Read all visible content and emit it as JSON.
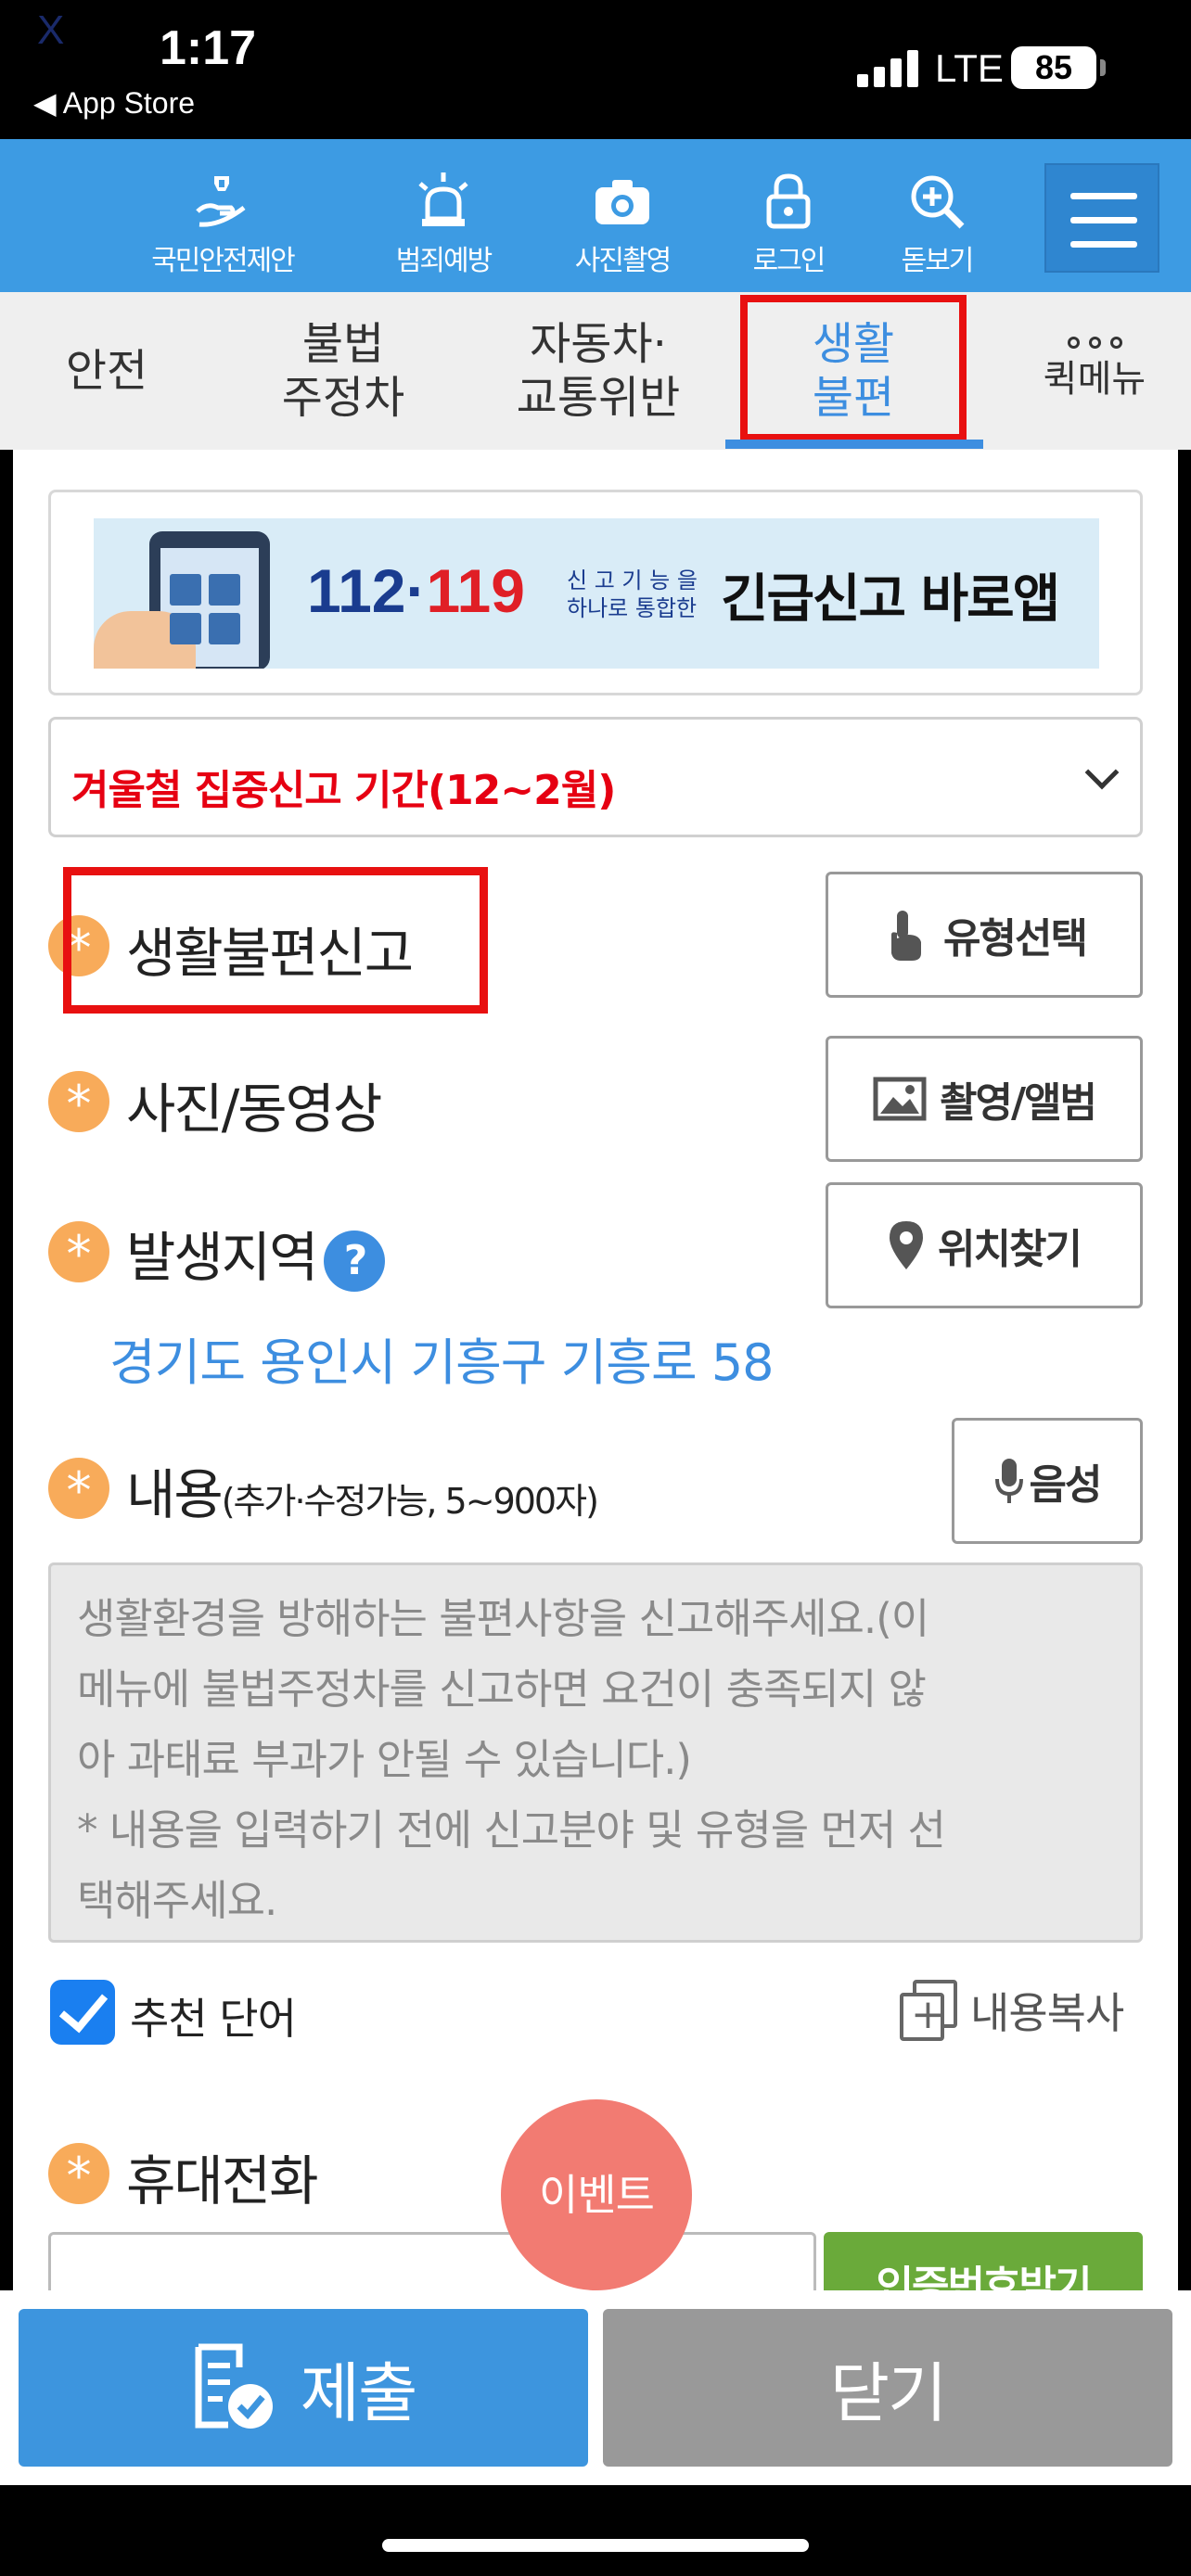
{
  "status_bar": {
    "time": "1:17",
    "back_app": "◀ App Store",
    "corner_mark": "X",
    "network": "LTE",
    "battery": "85"
  },
  "header": {
    "items": [
      {
        "label": "국민안전제안",
        "icon": "safety-proposal-icon"
      },
      {
        "label": "범죄예방",
        "icon": "siren-icon"
      },
      {
        "label": "사진촬영",
        "icon": "camera-icon"
      },
      {
        "label": "로그인",
        "icon": "lock-icon"
      },
      {
        "label": "돋보기",
        "icon": "magnifier-icon"
      }
    ],
    "menu_icon": "hamburger-menu-icon",
    "accent": "#3d9be3"
  },
  "tabs": {
    "items": [
      {
        "line1": "안전",
        "line2": ""
      },
      {
        "line1": "불법",
        "line2": "주정차"
      },
      {
        "line1": "자동차·",
        "line2": "교통위반"
      },
      {
        "line1": "생활",
        "line2": "불편"
      },
      {
        "line1": "",
        "line2": "퀵메뉴"
      }
    ],
    "active_index": 3,
    "active_color": "#3d8ee0"
  },
  "banner": {
    "num1": "112",
    "dot": "·",
    "num2": "119",
    "small_line1": "신 고 기 능 을",
    "small_line2": "하나로 통합한",
    "title": "긴급신고 바로앱"
  },
  "notice": {
    "text": "겨울철 집중신고 기간(12~2월)",
    "color": "#e60012"
  },
  "form": {
    "required_mark": "*",
    "report_type": {
      "label": "생활불편신고",
      "button": "유형선택",
      "button_icon": "touch-hand-icon"
    },
    "media": {
      "label": "사진/동영상",
      "button": "촬영/앨범",
      "button_icon": "image-icon"
    },
    "location": {
      "label": "발생지역",
      "help": "?",
      "button": "위치찾기",
      "button_icon": "location-pin-icon",
      "address": "경기도 용인시 기흥구 기흥로 58"
    },
    "content": {
      "label": "내용",
      "label_note": "(추가·수정가능, 5~900자)",
      "button": "음성",
      "button_icon": "microphone-icon",
      "placeholder_lines": [
        "생활환경을 방해하는 불편사항을 신고해주세요.(이",
        "메뉴에 불법주정차를 신고하면 요건이 충족되지 않",
        "아 과태료 부과가 안될 수 있습니다.)",
        "* 내용을 입력하기 전에 신고분야 및 유형을 먼저 선",
        "택해주세요."
      ]
    },
    "recommend_checkbox": {
      "label": "추천 단어",
      "checked": true
    },
    "copy_content": "내용복사",
    "phone": {
      "label": "휴대전화",
      "verify_button": "인증번호받기"
    }
  },
  "event_button": "이벤트",
  "bottom": {
    "submit": "제출",
    "submit_icon": "document-check-icon",
    "close": "닫기"
  }
}
